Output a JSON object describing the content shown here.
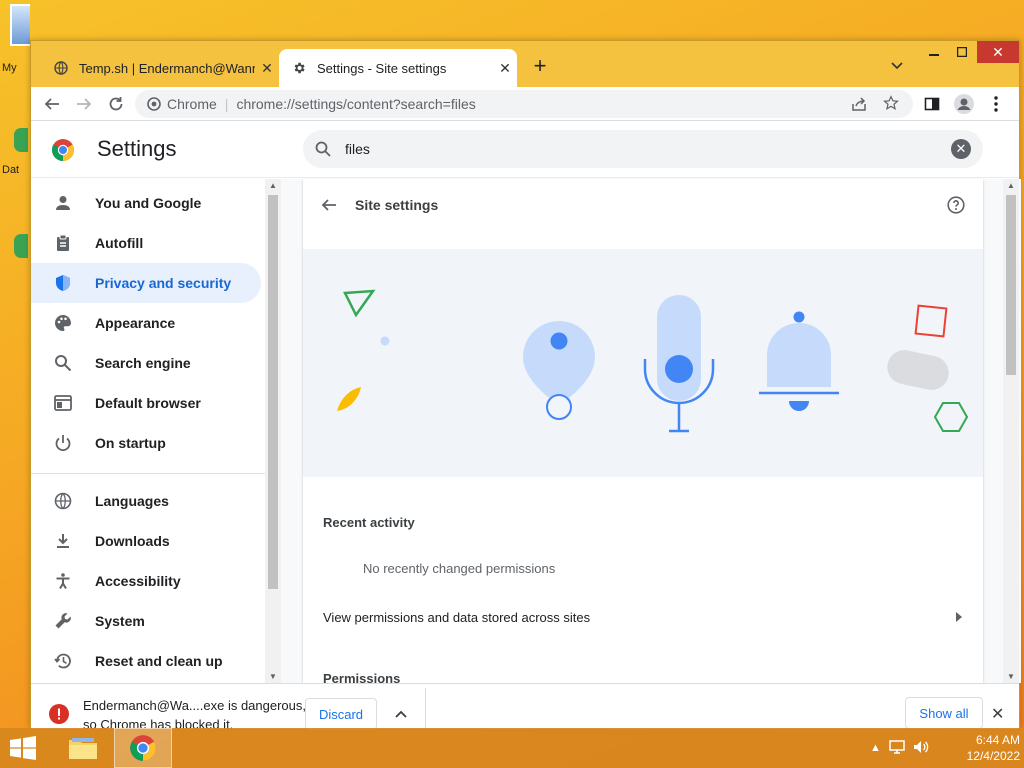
{
  "desktop": {
    "icons": [
      {
        "label": "My"
      },
      {
        "label": "Dat"
      },
      {
        "label": ""
      }
    ]
  },
  "browser": {
    "tabs": [
      {
        "title": "Temp.sh | Endermanch@WannaCry",
        "icon": "globe-icon",
        "active": false
      },
      {
        "title": "Settings - Site settings",
        "icon": "gear-icon",
        "active": true
      }
    ],
    "omnibox": {
      "scheme_label": "Chrome",
      "url": "chrome://settings/content?search=files"
    }
  },
  "settings": {
    "title": "Settings",
    "search": {
      "value": "files"
    },
    "nav": [
      {
        "label": "You and Google",
        "icon": "person-icon",
        "active": false
      },
      {
        "label": "Autofill",
        "icon": "clipboard-icon",
        "active": false
      },
      {
        "label": "Privacy and security",
        "icon": "shield-icon",
        "active": true
      },
      {
        "label": "Appearance",
        "icon": "palette-icon",
        "active": false
      },
      {
        "label": "Search engine",
        "icon": "search-icon",
        "active": false
      },
      {
        "label": "Default browser",
        "icon": "browser-icon",
        "active": false
      },
      {
        "label": "On startup",
        "icon": "power-icon",
        "active": false
      },
      {
        "label": "Languages",
        "icon": "globe-icon",
        "active": false
      },
      {
        "label": "Downloads",
        "icon": "download-icon",
        "active": false
      },
      {
        "label": "Accessibility",
        "icon": "accessibility-icon",
        "active": false
      },
      {
        "label": "System",
        "icon": "wrench-icon",
        "active": false
      },
      {
        "label": "Reset and clean up",
        "icon": "history-icon",
        "active": false
      }
    ]
  },
  "site_settings": {
    "title": "Site settings",
    "recent_activity_heading": "Recent activity",
    "no_permissions": "No recently changed permissions",
    "view_permissions_label": "View permissions and data stored across sites",
    "permissions_heading": "Permissions"
  },
  "download_bar": {
    "message_line1": "Endermanch@Wa....exe is dangerous,",
    "message_line2": "so Chrome has blocked it.",
    "discard_label": "Discard",
    "show_all_label": "Show all"
  },
  "taskbar": {
    "time": "6:44 AM",
    "date": "12/4/2022"
  },
  "colors": {
    "accent": "#1a73e8",
    "active_nav_bg": "#e8f0fe",
    "danger": "#d93025",
    "titlebar": "#f5c240"
  }
}
